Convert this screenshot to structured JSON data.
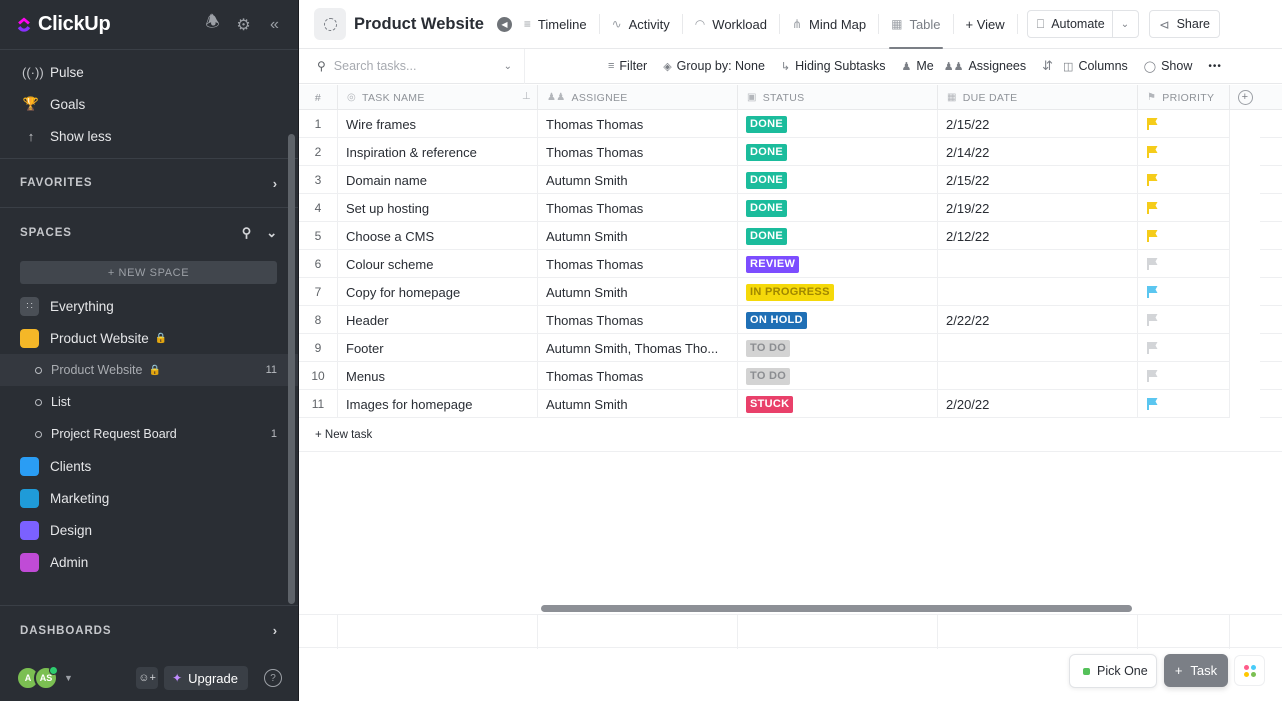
{
  "app": {
    "logo_text": "ClickUp",
    "brand_colors": [
      "#ff02f0",
      "#8930fd",
      "#49ccf9",
      "#ffc800"
    ]
  },
  "sidebar": {
    "header_icons": [
      "bell-icon",
      "gear-icon",
      "collapse-sidebar-icon"
    ],
    "nav": [
      {
        "label": "Pulse",
        "icon": "pulse-icon",
        "glyph": "((·))"
      },
      {
        "label": "Goals",
        "icon": "trophy-icon",
        "glyph": "🏆"
      },
      {
        "label": "Show less",
        "icon": "arrow-up-icon",
        "glyph": "↑"
      }
    ],
    "favorites_label": "FAVORITES",
    "spaces_label": "SPACES",
    "new_space_label": "+ NEW SPACE",
    "everything_label": "Everything",
    "spaces": [
      {
        "label": "Product Website",
        "color": "#f4b728",
        "locked": true
      },
      {
        "label": "Clients",
        "color": "#2a9df4"
      },
      {
        "label": "Marketing",
        "color": "#1f9bd8"
      },
      {
        "label": "Design",
        "color": "#7b61ff"
      },
      {
        "label": "Admin",
        "color": "#c04bd6"
      }
    ],
    "sub_items": [
      {
        "label": "Product Website",
        "count": "11",
        "active": true,
        "locked": true
      },
      {
        "label": "List",
        "count": ""
      },
      {
        "label": "Project Request Board",
        "count": "1"
      }
    ],
    "dashboards_label": "DASHBOARDS",
    "footer": {
      "avatar1": "A",
      "avatar2": "AS",
      "upgrade_label": "Upgrade",
      "help_glyph": "?"
    }
  },
  "topbar": {
    "title": "Product Website",
    "views": [
      {
        "label": "Timeline",
        "icon": "timeline-icon",
        "glyph": "≡"
      },
      {
        "label": "Activity",
        "icon": "activity-icon",
        "glyph": "∿"
      },
      {
        "label": "Workload",
        "icon": "workload-icon",
        "glyph": "◠"
      },
      {
        "label": "Mind Map",
        "icon": "mindmap-icon",
        "glyph": "⋔"
      },
      {
        "label": "Table",
        "icon": "table-icon",
        "glyph": "▦",
        "active": true
      }
    ],
    "add_view_label": "+ View",
    "automate_label": "Automate",
    "share_label": "Share"
  },
  "toolbar": {
    "search_placeholder": "Search tasks...",
    "filter_label": "Filter",
    "group_by_label": "Group by: None",
    "subtasks_label": "Hiding Subtasks",
    "me_label": "Me",
    "assignees_label": "Assignees",
    "columns_label": "Columns",
    "show_label": "Show",
    "more_glyph": "•••"
  },
  "table": {
    "headers": {
      "num": "#",
      "name": "TASK NAME",
      "assignee": "ASSIGNEE",
      "status": "STATUS",
      "due": "DUE DATE",
      "priority": "PRIORITY"
    },
    "status_colors": {
      "DONE": "#1bbc9c",
      "REVIEW": "#7c4dff",
      "IN PROGRESS": "#f5d90a",
      "ON HOLD": "#1f6fb5",
      "TO DO": "#d3d3d3",
      "STUCK": "#e9406a"
    },
    "status_text_colors": {
      "IN PROGRESS": "#a08700",
      "TO DO": "#8b8d91"
    },
    "priority_colors": {
      "high": "#f5cc1a",
      "normal": "#5bc6f0",
      "none": "#d3d5d8"
    },
    "rows": [
      {
        "num": "1",
        "name": "Wire frames",
        "assignee": "Thomas Thomas",
        "status": "DONE",
        "due": "2/15/22",
        "priority": "high"
      },
      {
        "num": "2",
        "name": "Inspiration & reference",
        "assignee": "Thomas Thomas",
        "status": "DONE",
        "due": "2/14/22",
        "priority": "high"
      },
      {
        "num": "3",
        "name": "Domain name",
        "assignee": "Autumn Smith",
        "status": "DONE",
        "due": "2/15/22",
        "priority": "high"
      },
      {
        "num": "4",
        "name": "Set up hosting",
        "assignee": "Thomas Thomas",
        "status": "DONE",
        "due": "2/19/22",
        "priority": "high"
      },
      {
        "num": "5",
        "name": "Choose a CMS",
        "assignee": "Autumn Smith",
        "status": "DONE",
        "due": "2/12/22",
        "priority": "high"
      },
      {
        "num": "6",
        "name": "Colour scheme",
        "assignee": "Thomas Thomas",
        "status": "REVIEW",
        "due": "",
        "priority": "none"
      },
      {
        "num": "7",
        "name": "Copy for homepage",
        "assignee": "Autumn Smith",
        "status": "IN PROGRESS",
        "due": "",
        "priority": "normal"
      },
      {
        "num": "8",
        "name": "Header",
        "assignee": "Thomas Thomas",
        "status": "ON HOLD",
        "due": "2/22/22",
        "priority": "none"
      },
      {
        "num": "9",
        "name": "Footer",
        "assignee": "Autumn Smith, Thomas Tho...",
        "status": "TO DO",
        "due": "",
        "priority": "none"
      },
      {
        "num": "10",
        "name": "Menus",
        "assignee": "Thomas Thomas",
        "status": "TO DO",
        "due": "",
        "priority": "none"
      },
      {
        "num": "11",
        "name": "Images for homepage",
        "assignee": "Autumn Smith",
        "status": "STUCK",
        "due": "2/20/22",
        "priority": "normal"
      }
    ],
    "new_task_label": "+ New task"
  },
  "floating": {
    "pick_one_label": "Pick One",
    "task_label": "Task"
  }
}
